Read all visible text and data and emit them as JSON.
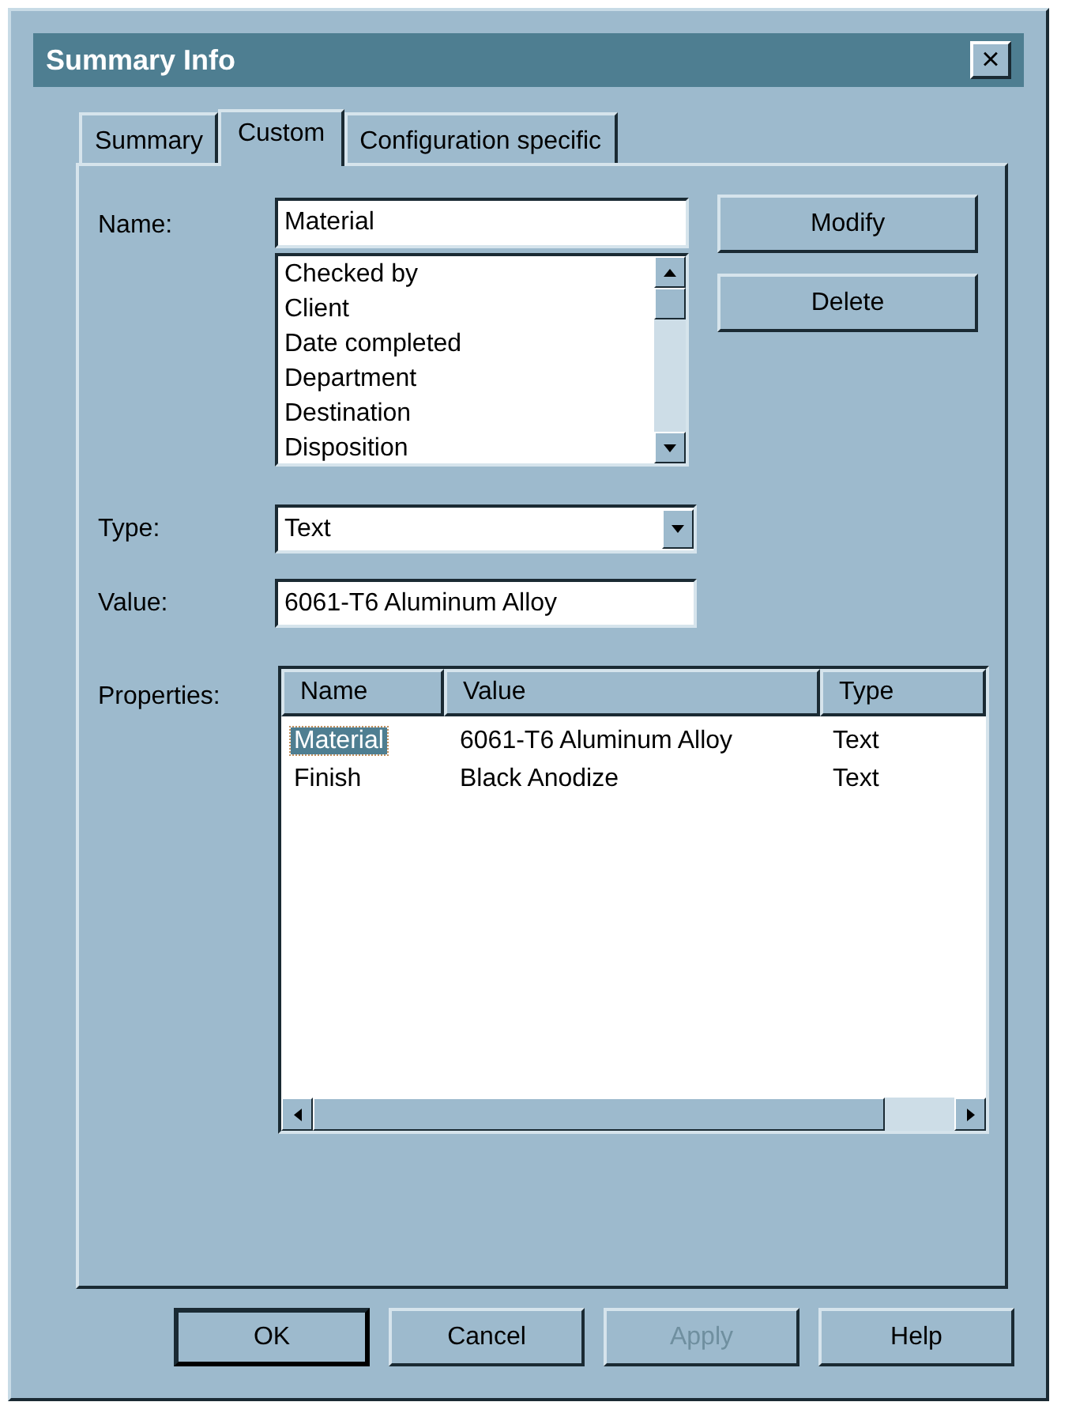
{
  "window": {
    "title": "Summary Info",
    "close": "×"
  },
  "tabs": [
    {
      "label": "Summary",
      "selected": false
    },
    {
      "label": "Custom",
      "selected": true
    },
    {
      "label": "Configuration specific",
      "selected": false
    }
  ],
  "name_label": "Name:",
  "name_field": {
    "value": "Material"
  },
  "name_list": {
    "items": [
      "Checked by",
      "Client",
      "Date completed",
      "Department",
      "Destination",
      "Disposition"
    ]
  },
  "side_buttons": [
    {
      "label": "Modify"
    },
    {
      "label": "Delete"
    }
  ],
  "type_label": "Type:",
  "type_dropdown": {
    "value": "Text"
  },
  "value_label": "Value:",
  "value_field": {
    "value": "6061-T6 Aluminum Alloy"
  },
  "properties_label": "Properties:",
  "properties": {
    "columns": [
      "Name",
      "Value",
      "Type"
    ],
    "rows": [
      {
        "cells": [
          "Material",
          "6061-T6 Aluminum Alloy",
          "Text"
        ],
        "selected": true
      },
      {
        "cells": [
          "Finish",
          "Black Anodize",
          "Text"
        ],
        "selected": false
      }
    ]
  },
  "buttons": [
    {
      "label": "OK",
      "default": true,
      "disabled": false
    },
    {
      "label": "Cancel",
      "default": false,
      "disabled": false
    },
    {
      "label": "Apply",
      "default": false,
      "disabled": true
    },
    {
      "label": "Help",
      "default": false,
      "disabled": false
    }
  ]
}
